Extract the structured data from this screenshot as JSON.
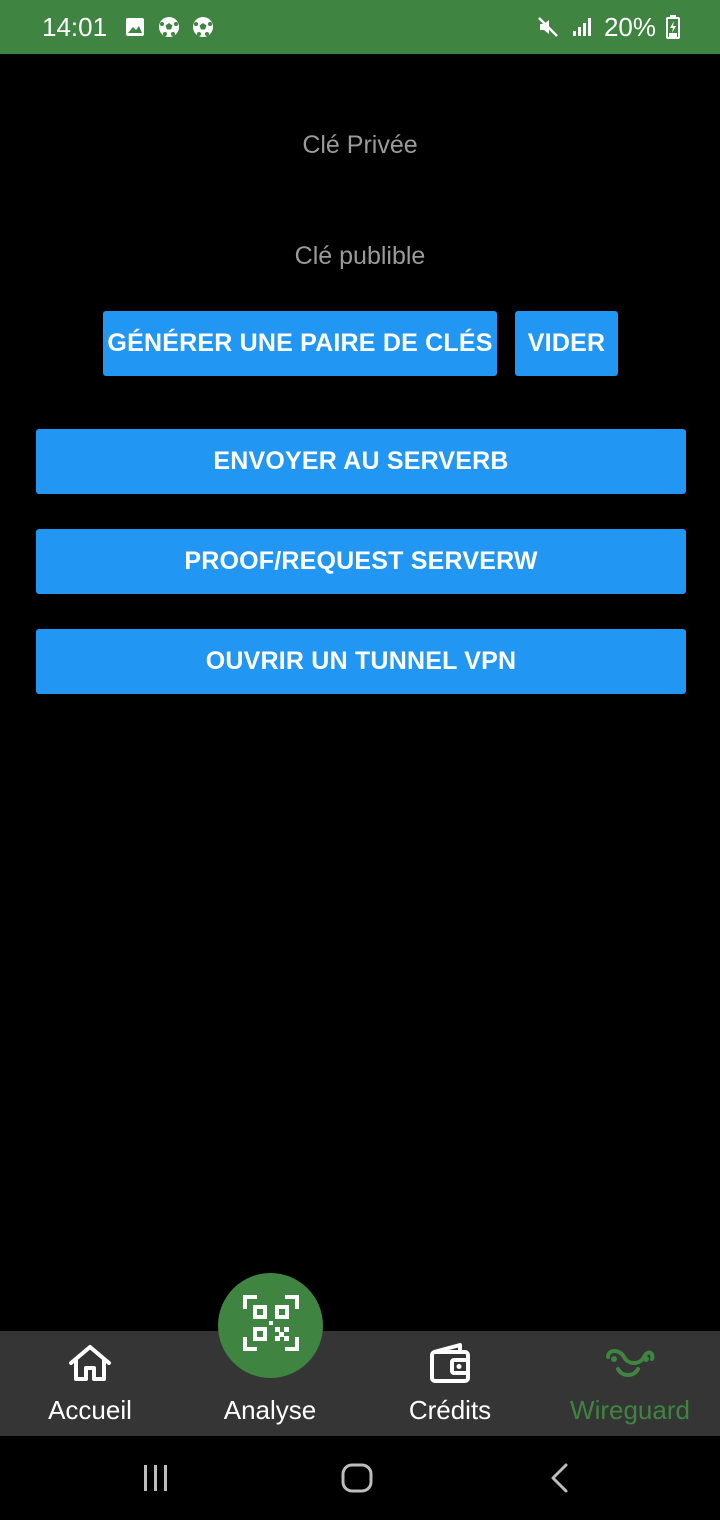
{
  "status_bar": {
    "time": "14:01",
    "left_icons": [
      "image-icon",
      "soccer-ball-icon",
      "soccer-ball-icon"
    ],
    "right_icons": [
      "mute-icon",
      "signal-icon",
      "battery-charging-icon"
    ],
    "battery": "20%"
  },
  "main": {
    "private_key_label": "Clé Privée",
    "public_key_label": "Clé publible",
    "generate_button": "GÉNÉRER UNE PAIRE DE CLÉS",
    "clear_button": "VIDER",
    "send_server_button": "ENVOYER AU SERVERB",
    "proof_request_button": "PROOF/REQUEST SERVERW",
    "open_tunnel_button": "OUVRIR UN TUNNEL VPN"
  },
  "bottom_nav": {
    "items": [
      {
        "label": "Accueil",
        "icon": "home-icon"
      },
      {
        "label": "Analyse",
        "icon": "qr-scan-icon"
      },
      {
        "label": "Crédits",
        "icon": "wallet-icon"
      },
      {
        "label": "Wireguard",
        "icon": "wireguard-icon",
        "active": true
      }
    ]
  },
  "colors": {
    "accent_green": "#3f8440",
    "button_blue": "#2196f3",
    "background": "#000000",
    "nav_background": "#353535"
  }
}
